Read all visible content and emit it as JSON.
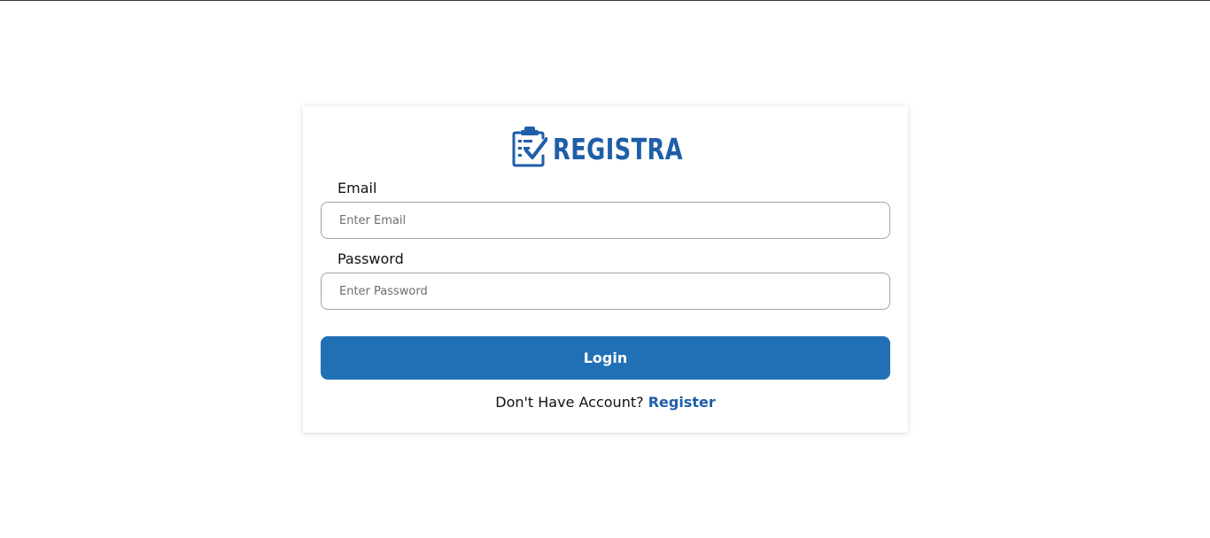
{
  "logo": {
    "icon": "clipboard-check-icon",
    "text": "REGISTRA",
    "color": "#1f5ea8"
  },
  "form": {
    "email": {
      "label": "Email",
      "placeholder": "Enter Email",
      "value": ""
    },
    "password": {
      "label": "Password",
      "placeholder": "Enter Password",
      "value": ""
    },
    "login_label": "Login",
    "login_color": "#2170b6"
  },
  "register": {
    "prompt": "Don't Have Account?",
    "link_label": "Register"
  }
}
